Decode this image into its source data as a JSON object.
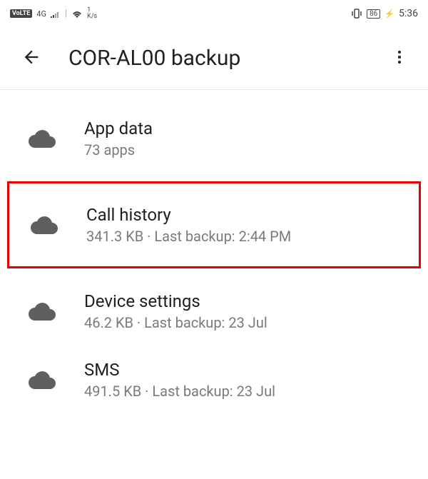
{
  "status": {
    "volte": "VoLTE",
    "network": "4G",
    "speed_value": "1",
    "speed_unit": "K/s",
    "battery": "86",
    "time": "5:36"
  },
  "header": {
    "title": "COR-AL00 backup"
  },
  "items": [
    {
      "title": "App data",
      "subtitle": "73 apps",
      "highlighted": false
    },
    {
      "title": "Call history",
      "subtitle": "341.3 KB · Last backup: 2:44 PM",
      "highlighted": true
    },
    {
      "title": "Device settings",
      "subtitle": "46.2 KB · Last backup: 23 Jul",
      "highlighted": false
    },
    {
      "title": "SMS",
      "subtitle": "491.5 KB · Last backup: 23 Jul",
      "highlighted": false
    }
  ]
}
